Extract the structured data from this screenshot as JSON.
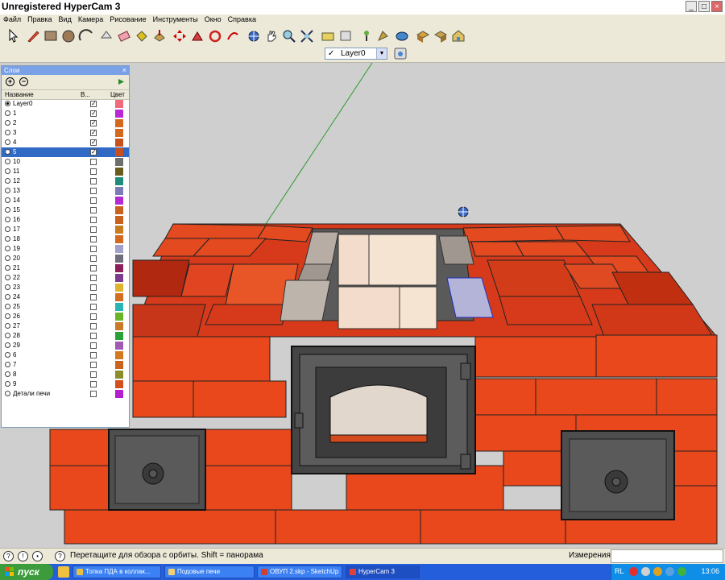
{
  "window": {
    "title": "Unregistered HyperCam 3",
    "buttons": [
      "_",
      "□",
      "×"
    ]
  },
  "menu": [
    "Файл",
    "Правка",
    "Вид",
    "Камера",
    "Рисование",
    "Инструменты",
    "Окно",
    "Справка"
  ],
  "toolbar": {
    "tools": [
      "select-tool",
      "pencil-tool",
      "rectangle-tool",
      "circle-tool",
      "arc-tool",
      "eraser-tool",
      "paint-bucket-tool",
      "push-pull-tool",
      "move-tool",
      "rotate-tool",
      "follow-me-tool",
      "orbit-tool",
      "pan-tool",
      "zoom-tool",
      "zoom-extents-tool",
      "tape-measure-tool",
      "text-tool",
      "iso-view",
      "top-view",
      "front-view",
      "right-view",
      "back-view",
      "left-view"
    ],
    "layer_select": {
      "checked": "✓",
      "value": "Layer0"
    }
  },
  "layers_panel": {
    "title": "Слои",
    "add": "+",
    "remove": "−",
    "col_name": "Название",
    "col_visible": "В...",
    "col_color": "Цвет",
    "rows": [
      {
        "name": "Layer0",
        "active": true,
        "visible": true,
        "color": "#ef6a7a"
      },
      {
        "name": "1",
        "active": false,
        "visible": true,
        "color": "#b72ad6"
      },
      {
        "name": "2",
        "active": false,
        "visible": true,
        "color": "#d2691e"
      },
      {
        "name": "3",
        "active": false,
        "visible": true,
        "color": "#d2691e"
      },
      {
        "name": "4",
        "active": false,
        "visible": true,
        "color": "#c8501e"
      },
      {
        "name": "5",
        "active": false,
        "visible": true,
        "color": "#c8501e",
        "selected": true
      },
      {
        "name": "10",
        "active": false,
        "visible": false,
        "color": "#6e6e6e"
      },
      {
        "name": "11",
        "active": false,
        "visible": false,
        "color": "#6b5a1e"
      },
      {
        "name": "12",
        "active": false,
        "visible": false,
        "color": "#1e8c7a"
      },
      {
        "name": "13",
        "active": false,
        "visible": false,
        "color": "#7a7ab4"
      },
      {
        "name": "14",
        "active": false,
        "visible": false,
        "color": "#b42ad2"
      },
      {
        "name": "15",
        "active": false,
        "visible": false,
        "color": "#c8601e"
      },
      {
        "name": "16",
        "active": false,
        "visible": false,
        "color": "#c8601e"
      },
      {
        "name": "17",
        "active": false,
        "visible": false,
        "color": "#c87a1e"
      },
      {
        "name": "18",
        "active": false,
        "visible": false,
        "color": "#d2691e"
      },
      {
        "name": "19",
        "active": false,
        "visible": false,
        "color": "#a0a0c8"
      },
      {
        "name": "20",
        "active": false,
        "visible": false,
        "color": "#6e6e7a"
      },
      {
        "name": "21",
        "active": false,
        "visible": false,
        "color": "#8c1e5a"
      },
      {
        "name": "22",
        "active": false,
        "visible": false,
        "color": "#7a3c8c"
      },
      {
        "name": "23",
        "active": false,
        "visible": false,
        "color": "#e0b42a"
      },
      {
        "name": "24",
        "active": false,
        "visible": false,
        "color": "#d26e1e"
      },
      {
        "name": "25",
        "active": false,
        "visible": false,
        "color": "#2ab4b4"
      },
      {
        "name": "26",
        "active": false,
        "visible": false,
        "color": "#6ab42a"
      },
      {
        "name": "27",
        "active": false,
        "visible": false,
        "color": "#c87a2a"
      },
      {
        "name": "28",
        "active": false,
        "visible": false,
        "color": "#2aa03c"
      },
      {
        "name": "29",
        "active": false,
        "visible": false,
        "color": "#a05ab4"
      },
      {
        "name": "6",
        "active": false,
        "visible": false,
        "color": "#d2781e"
      },
      {
        "name": "7",
        "active": false,
        "visible": false,
        "color": "#c8641e"
      },
      {
        "name": "8",
        "active": false,
        "visible": false,
        "color": "#8c8c2a"
      },
      {
        "name": "9",
        "active": false,
        "visible": false,
        "color": "#d2501e"
      },
      {
        "name": "Детали печи",
        "active": false,
        "visible": false,
        "color": "#b41ed2"
      }
    ]
  },
  "status": {
    "message": "Перетащите для обзора с орбиты.  Shift = панорама",
    "measure_label": "Измерения",
    "measure_value": ""
  },
  "taskbar": {
    "start": "пуск",
    "tasks": [
      {
        "label": "Топка ПДА в коллак...",
        "color": "#e8c040"
      },
      {
        "label": "Подовые печи",
        "color": "#f0d070"
      },
      {
        "label": "ОВУП 2.skp - SketchUp",
        "color": "#d04030"
      },
      {
        "label": "HyperCam 3",
        "color": "#e04040"
      }
    ],
    "lang": "RL",
    "clock": "13:06"
  }
}
